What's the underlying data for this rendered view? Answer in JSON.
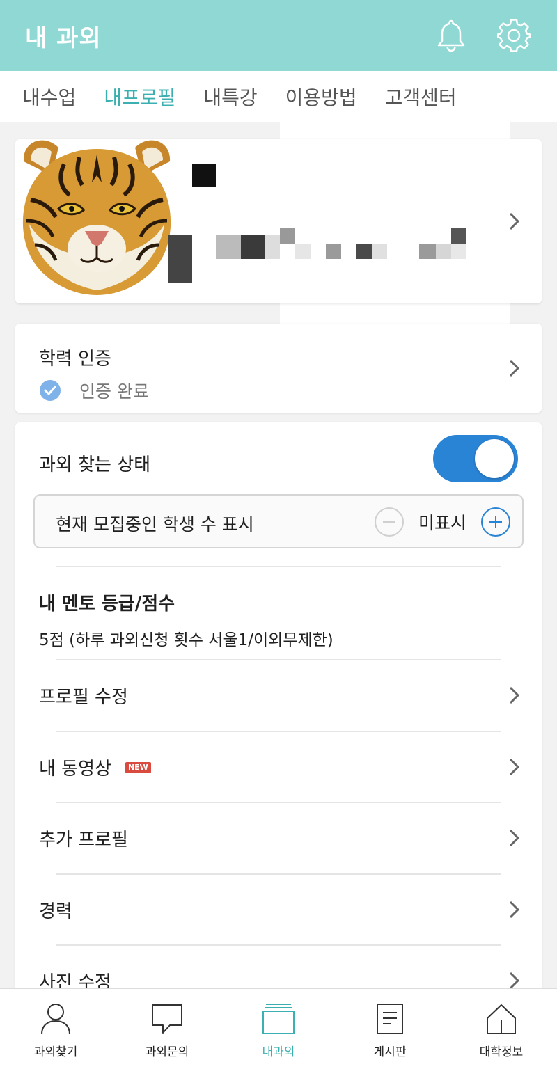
{
  "app_bar": {
    "title": "내 과외",
    "icons": [
      "bell-icon",
      "gear-icon"
    ],
    "color": "#8fd8d3"
  },
  "tabs": [
    {
      "label": "내수업",
      "active": false
    },
    {
      "label": "내프로필",
      "active": true
    },
    {
      "label": "내특강",
      "active": false
    },
    {
      "label": "이용방법",
      "active": false
    },
    {
      "label": "고객센터",
      "active": false
    }
  ],
  "education": {
    "title": "학력 인증",
    "status": "인증 완료"
  },
  "tutoring_status": {
    "label": "과외 찾는 상태",
    "toggle_on": true
  },
  "recruit_display": {
    "label": "현재 모집중인 학생 수 표시",
    "value": "미표시"
  },
  "grade": {
    "title": "내 멘토 등급/점수",
    "description": "5점 (하루 과외신청 횟수 서울1/이외무제한)"
  },
  "menu": [
    {
      "label": "프로필 수정"
    },
    {
      "label": "내 동영상",
      "badge": "NEW"
    },
    {
      "label": "추가 프로필"
    },
    {
      "label": "경력"
    },
    {
      "label": "사진 수정"
    }
  ],
  "bottom_nav": [
    {
      "label": "과외찾기",
      "icon": "person-icon",
      "active": false
    },
    {
      "label": "과외문의",
      "icon": "chat-bubble-icon",
      "active": false
    },
    {
      "label": "내과외",
      "icon": "stack-icon",
      "active": true
    },
    {
      "label": "게시판",
      "icon": "document-icon",
      "active": false
    },
    {
      "label": "대학정보",
      "icon": "house-icon",
      "active": false
    }
  ],
  "colors": {
    "accent": "#3cb0b0",
    "toggle": "#2a84d6",
    "badge": "#d94a3f"
  }
}
